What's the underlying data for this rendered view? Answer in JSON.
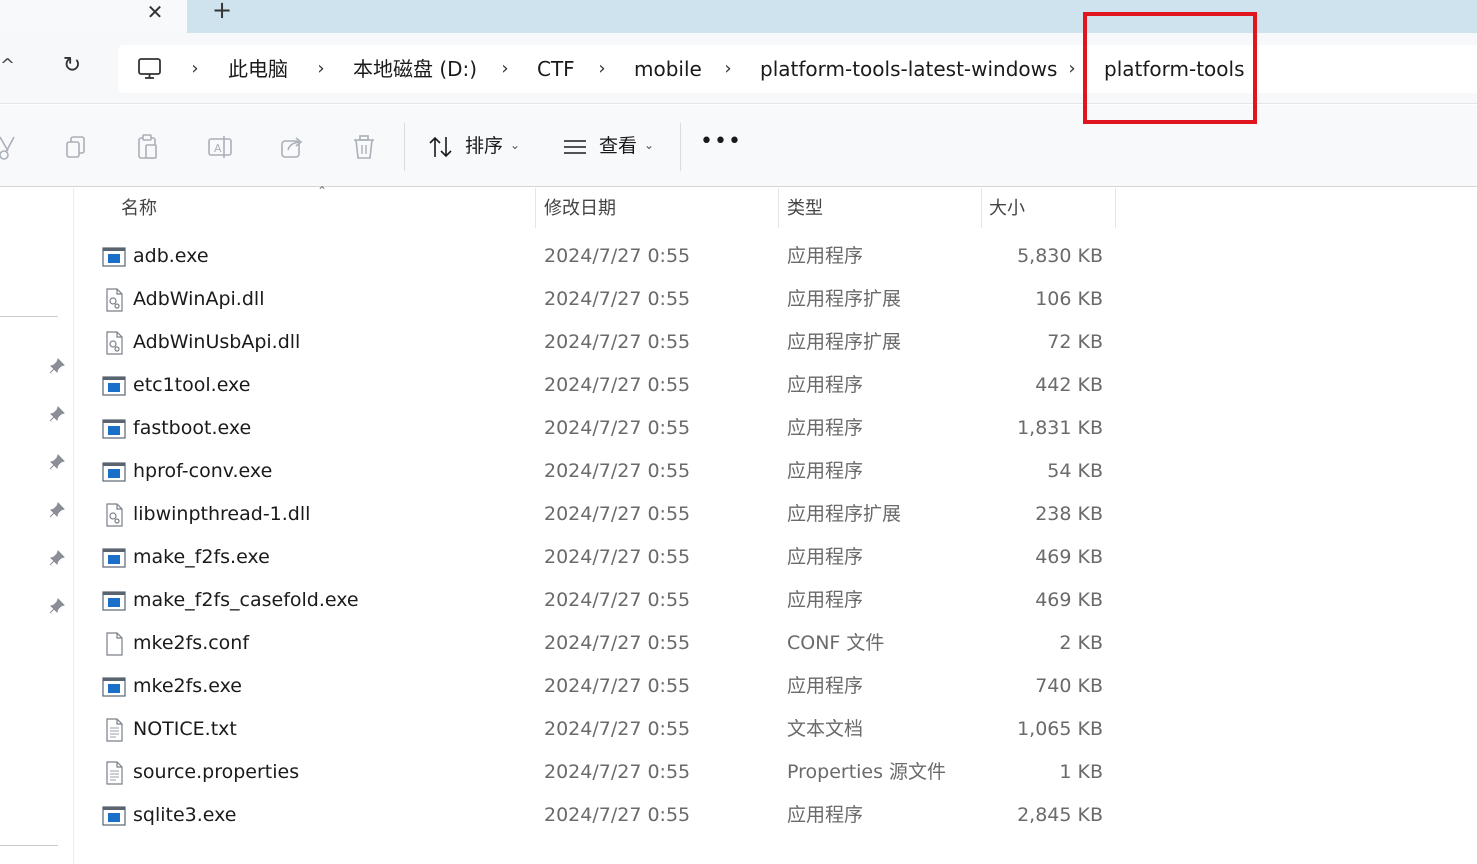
{
  "tabs": {
    "close_glyph": "✕",
    "new_glyph": "+"
  },
  "nav": {
    "up_glyph": "^",
    "refresh_glyph": "↻"
  },
  "breadcrumb": {
    "root_icon": "monitor-icon",
    "separator": "›",
    "items": [
      "此电脑",
      "本地磁盘 (D:)",
      "CTF",
      "mobile",
      "platform-tools-latest-windows",
      "platform-tools"
    ]
  },
  "toolbar": {
    "icons": [
      "cut-icon",
      "copy-icon",
      "paste-icon",
      "rename-icon",
      "share-icon",
      "delete-icon"
    ],
    "sort_label": "排序",
    "view_label": "查看",
    "more_glyph": "•••"
  },
  "columns": {
    "name": "名称",
    "date": "修改日期",
    "type": "类型",
    "size": "大小"
  },
  "files": [
    {
      "name": "adb.exe",
      "date": "2024/7/27 0:55",
      "type": "应用程序",
      "size": "5,830 KB",
      "icon": "exe"
    },
    {
      "name": "AdbWinApi.dll",
      "date": "2024/7/27 0:55",
      "type": "应用程序扩展",
      "size": "106 KB",
      "icon": "dll"
    },
    {
      "name": "AdbWinUsbApi.dll",
      "date": "2024/7/27 0:55",
      "type": "应用程序扩展",
      "size": "72 KB",
      "icon": "dll"
    },
    {
      "name": "etc1tool.exe",
      "date": "2024/7/27 0:55",
      "type": "应用程序",
      "size": "442 KB",
      "icon": "exe"
    },
    {
      "name": "fastboot.exe",
      "date": "2024/7/27 0:55",
      "type": "应用程序",
      "size": "1,831 KB",
      "icon": "exe"
    },
    {
      "name": "hprof-conv.exe",
      "date": "2024/7/27 0:55",
      "type": "应用程序",
      "size": "54 KB",
      "icon": "exe"
    },
    {
      "name": "libwinpthread-1.dll",
      "date": "2024/7/27 0:55",
      "type": "应用程序扩展",
      "size": "238 KB",
      "icon": "dll"
    },
    {
      "name": "make_f2fs.exe",
      "date": "2024/7/27 0:55",
      "type": "应用程序",
      "size": "469 KB",
      "icon": "exe"
    },
    {
      "name": "make_f2fs_casefold.exe",
      "date": "2024/7/27 0:55",
      "type": "应用程序",
      "size": "469 KB",
      "icon": "exe"
    },
    {
      "name": "mke2fs.conf",
      "date": "2024/7/27 0:55",
      "type": "CONF 文件",
      "size": "2 KB",
      "icon": "blank"
    },
    {
      "name": "mke2fs.exe",
      "date": "2024/7/27 0:55",
      "type": "应用程序",
      "size": "740 KB",
      "icon": "exe"
    },
    {
      "name": "NOTICE.txt",
      "date": "2024/7/27 0:55",
      "type": "文本文档",
      "size": "1,065 KB",
      "icon": "txt"
    },
    {
      "name": "source.properties",
      "date": "2024/7/27 0:55",
      "type": "Properties 源文件",
      "size": "1 KB",
      "icon": "txt"
    },
    {
      "name": "sqlite3.exe",
      "date": "2024/7/27 0:55",
      "type": "应用程序",
      "size": "2,845 KB",
      "icon": "exe"
    }
  ],
  "colors": {
    "highlight": "#e0161e",
    "exe_icon": "#1a6fc9",
    "tabstrip": "#cfe3ee"
  }
}
